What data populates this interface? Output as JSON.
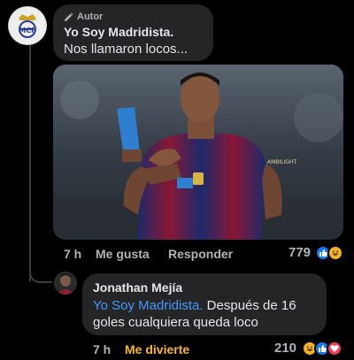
{
  "comment": {
    "author_badge": "Autor",
    "author_name": "Yo Soy Madridista.",
    "text": "Nos llamaron locos...",
    "time": "7 h",
    "like_label": "Me gusta",
    "reply_label": "Responder",
    "reaction_count": "779",
    "reactions": [
      "like",
      "haha"
    ]
  },
  "reply": {
    "author_name": "Jonathan Mejía",
    "mention": "Yo Soy Madridista.",
    "text": " Después de 16 goles cualquiera queda loco",
    "time": "7 h",
    "reaction_label": "Me divierte",
    "reaction_count": "210",
    "reactions": [
      "haha",
      "like",
      "love"
    ]
  },
  "colors": {
    "background": "#000000",
    "bubble": "#242526",
    "mention": "#4599ff",
    "haha_active": "#f7b928"
  }
}
